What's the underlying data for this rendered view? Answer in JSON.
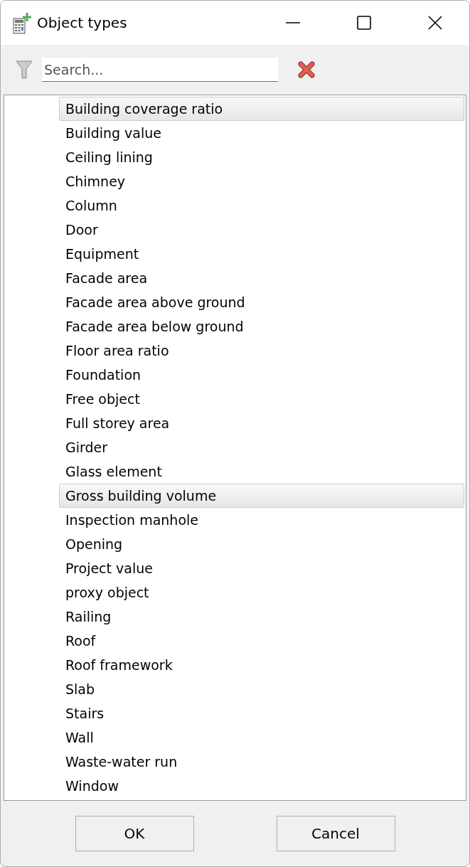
{
  "window": {
    "title": "Object types"
  },
  "search": {
    "placeholder": "Search..."
  },
  "items": [
    {
      "label": "Building coverage ratio",
      "selected": true
    },
    {
      "label": "Building value",
      "selected": false
    },
    {
      "label": "Ceiling lining",
      "selected": false
    },
    {
      "label": "Chimney",
      "selected": false
    },
    {
      "label": "Column",
      "selected": false
    },
    {
      "label": "Door",
      "selected": false
    },
    {
      "label": "Equipment",
      "selected": false
    },
    {
      "label": "Facade area",
      "selected": false
    },
    {
      "label": "Facade area above ground",
      "selected": false
    },
    {
      "label": "Facade area below ground",
      "selected": false
    },
    {
      "label": "Floor area ratio",
      "selected": false
    },
    {
      "label": "Foundation",
      "selected": false
    },
    {
      "label": "Free object",
      "selected": false
    },
    {
      "label": "Full storey area",
      "selected": false
    },
    {
      "label": "Girder",
      "selected": false
    },
    {
      "label": "Glass element",
      "selected": false
    },
    {
      "label": "Gross building volume",
      "selected": true
    },
    {
      "label": "Inspection manhole",
      "selected": false
    },
    {
      "label": "Opening",
      "selected": false
    },
    {
      "label": "Project value",
      "selected": false
    },
    {
      "label": "proxy object",
      "selected": false
    },
    {
      "label": "Railing",
      "selected": false
    },
    {
      "label": "Roof",
      "selected": false
    },
    {
      "label": "Roof framework",
      "selected": false
    },
    {
      "label": "Slab",
      "selected": false
    },
    {
      "label": "Stairs",
      "selected": false
    },
    {
      "label": "Wall",
      "selected": false
    },
    {
      "label": "Waste-water run",
      "selected": false
    },
    {
      "label": "Window",
      "selected": false
    }
  ],
  "buttons": [
    "OK",
    "Cancel"
  ]
}
